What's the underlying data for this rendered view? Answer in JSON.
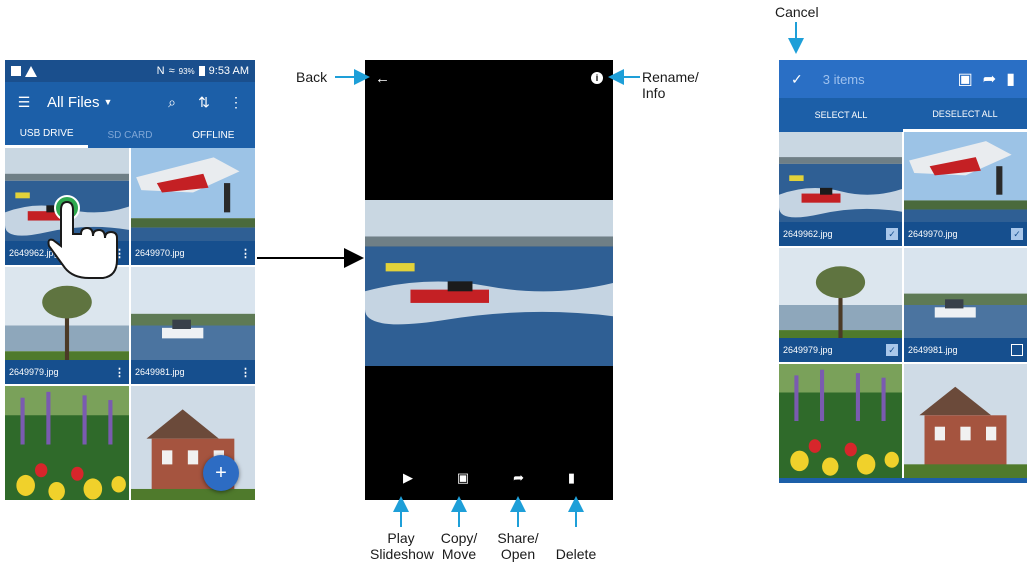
{
  "file_browser": {
    "status": {
      "time": "9:53 AM",
      "battery": "93%"
    },
    "toolbar": {
      "title": "All Files"
    },
    "tabs": [
      {
        "label": "USB DRIVE"
      },
      {
        "label": "SD CARD"
      },
      {
        "label": "OFFLINE"
      }
    ],
    "files": [
      {
        "name": "2649962.jpg"
      },
      {
        "name": "2649970.jpg"
      },
      {
        "name": "2649979.jpg"
      },
      {
        "name": "2649981.jpg"
      }
    ],
    "fab_label": "+"
  },
  "selection": {
    "count_label": "3 items",
    "select_all": "SELECT ALL",
    "deselect_all": "DESELECT ALL",
    "files": [
      {
        "name": "2649962.jpg",
        "checked": true
      },
      {
        "name": "2649970.jpg",
        "checked": true
      },
      {
        "name": "2649979.jpg",
        "checked": true
      },
      {
        "name": "2649981.jpg",
        "checked": false
      }
    ]
  },
  "callouts": {
    "back": "Back",
    "rename_info": [
      "Rename/",
      "Info"
    ],
    "cancel": "Cancel",
    "play": [
      "Play",
      "Slideshow"
    ],
    "copy": [
      "Copy/",
      "Move"
    ],
    "share": [
      "Share/",
      "Open"
    ],
    "delete": "Delete"
  },
  "colors": {
    "app_blue": "#1c5fa8",
    "caption_blue": "#164f8e",
    "callout_arrow": "#1e9fd8"
  }
}
